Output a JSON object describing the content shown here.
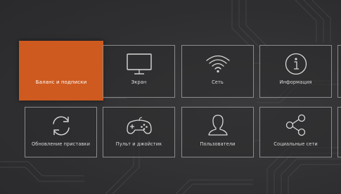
{
  "menu": {
    "row1": [
      {
        "label": "Баланс и подписки",
        "icon": "none",
        "active": true
      },
      {
        "label": "Экран",
        "icon": "monitor-icon"
      },
      {
        "label": "Сеть",
        "icon": "wifi-icon"
      },
      {
        "label": "Информация",
        "icon": "info-icon"
      }
    ],
    "row2": [
      {
        "label": "Обновление приставки",
        "icon": "refresh-icon"
      },
      {
        "label": "Пульт и джойстик",
        "icon": "gamepad-icon"
      },
      {
        "label": "Пользователи",
        "icon": "user-icon"
      },
      {
        "label": "Социальные сети",
        "icon": "share-icon"
      }
    ]
  },
  "colors": {
    "accent": "#ce5a1f",
    "background": "#2f2f31",
    "tile_border": "#8b8b8b",
    "text": "#dcdcdc"
  }
}
